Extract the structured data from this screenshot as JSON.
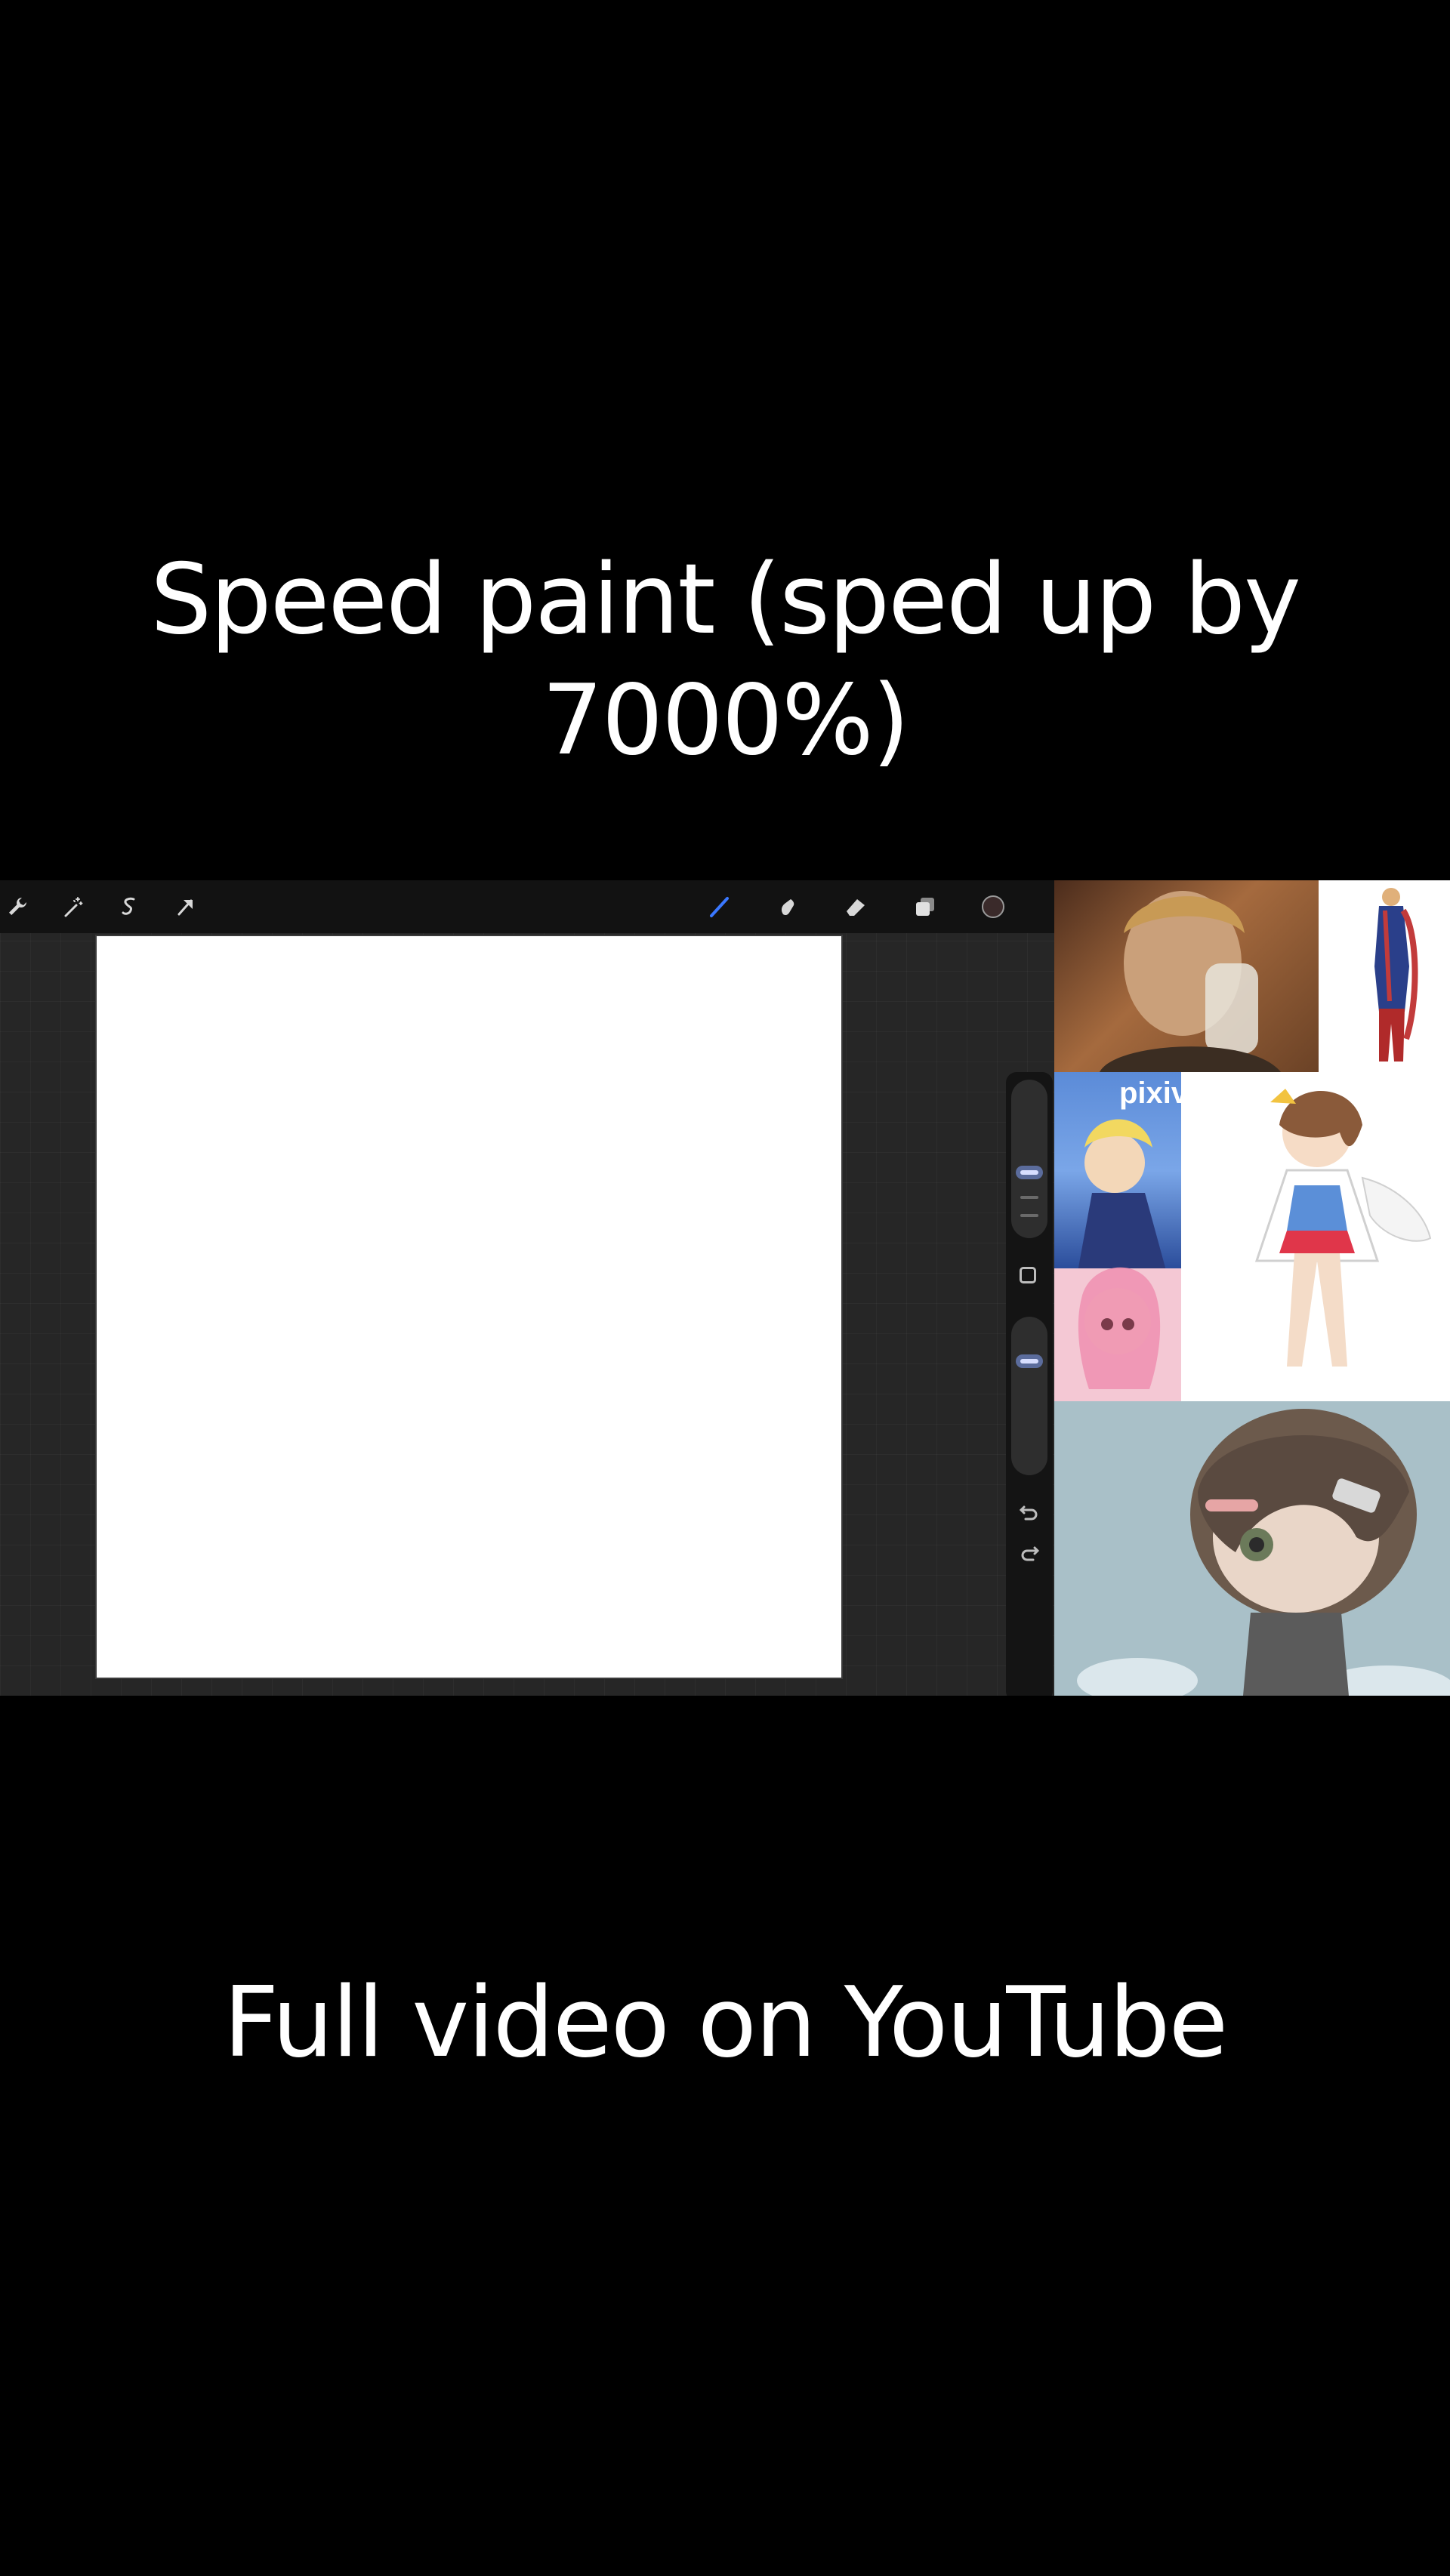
{
  "captions": {
    "top": "Speed paint (sped up by 7000%)",
    "bottom": "Full video on YouTube"
  },
  "toolbar": {
    "left_tools": [
      "wrench-icon",
      "magic-wand-icon",
      "selection-icon",
      "transform-arrow-icon"
    ],
    "right_tools": [
      "brush-icon",
      "smudge-icon",
      "eraser-icon",
      "layers-icon",
      "color-swatch-icon"
    ],
    "active_tool": "brush",
    "current_color": "#3a2a2a"
  },
  "sidebar": {
    "icons": [
      "undo-icon",
      "redo-icon"
    ]
  },
  "collage": {
    "magazine_logo": "pixiv"
  },
  "colors": {
    "background": "#000000",
    "toolbar": "#121212",
    "workspace": "#262626",
    "canvas": "#ffffff",
    "accent": "#3a78ff"
  }
}
